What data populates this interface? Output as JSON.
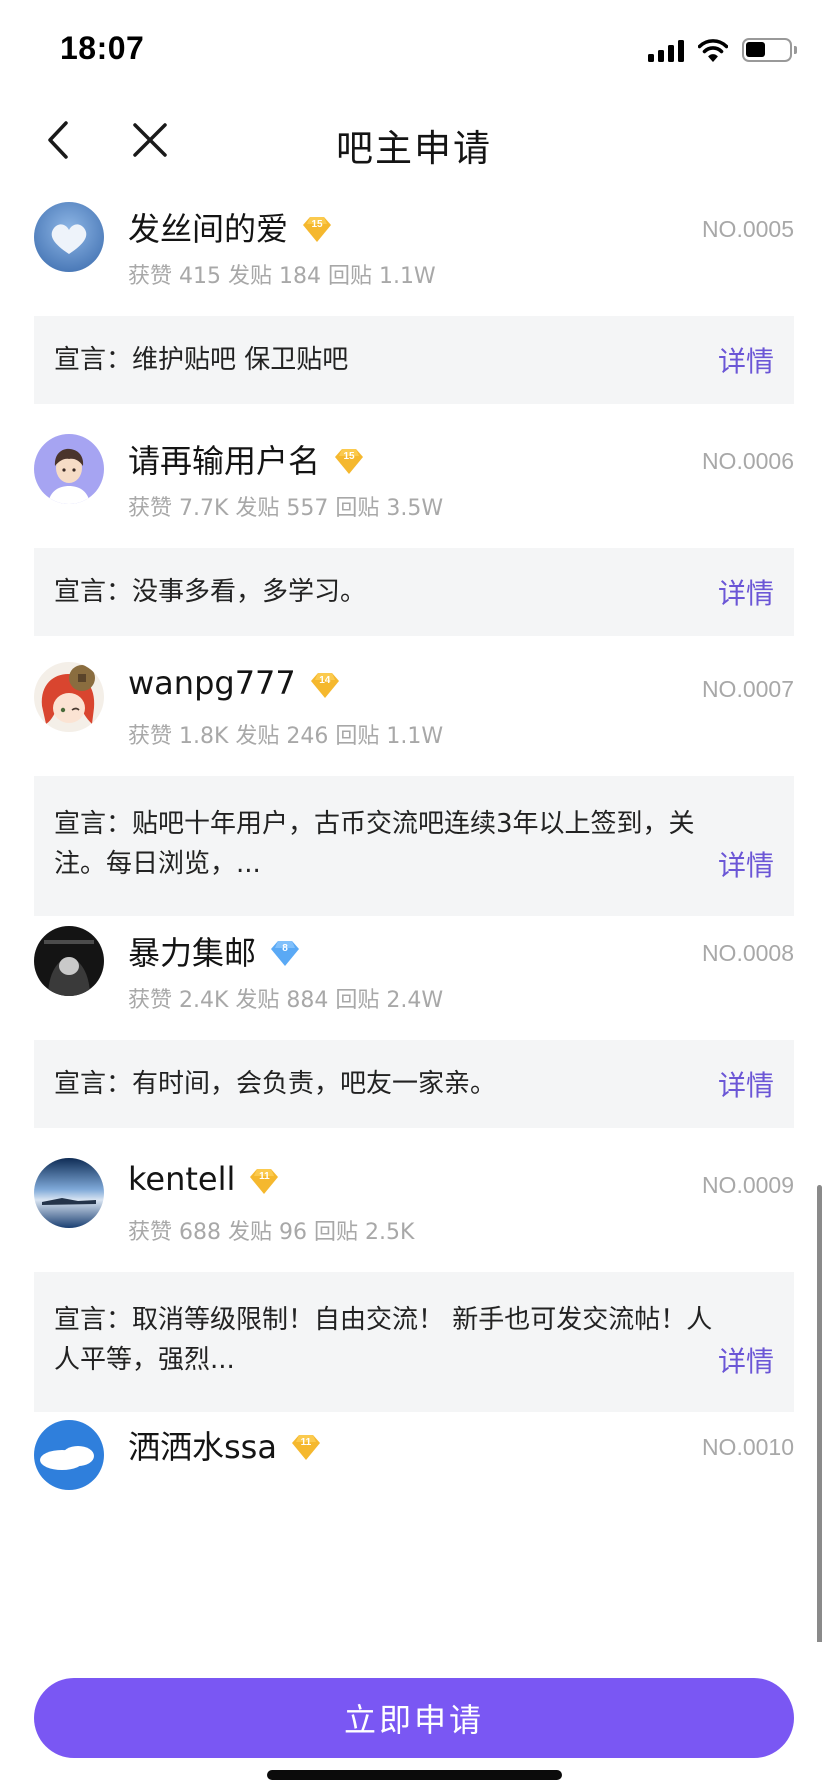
{
  "status_bar": {
    "time": "18:07"
  },
  "nav": {
    "title": "吧主申请"
  },
  "applicants": [
    {
      "name": "发丝间的爱",
      "level": "15",
      "stats": "获赞 415 发贴 184 回贴 1.1W",
      "number": "NO.0005",
      "declaration": "宣言：维护贴吧 保卫贴吧",
      "detail": "详情"
    },
    {
      "name": "请再输用户名",
      "level": "15",
      "stats": "获赞 7.7K 发贴 557 回贴 3.5W",
      "number": "NO.0006",
      "declaration": "宣言：没事多看，多学习。",
      "detail": "详情"
    },
    {
      "name": "wanpg777",
      "level": "14",
      "stats": "获赞 1.8K 发贴 246 回贴 1.1W",
      "number": "NO.0007",
      "declaration_line1": "宣言：贴吧十年用户，古币交流吧连续3年以上签到，关",
      "declaration_line2": "注。每日浏览，...",
      "detail": "详情"
    },
    {
      "name": "暴力集邮",
      "level": "8",
      "stats": "获赞 2.4K 发贴 884 回贴 2.4W",
      "number": "NO.0008",
      "declaration": "宣言：有时间，会负责，吧友一家亲。",
      "detail": "详情"
    },
    {
      "name": "kentell",
      "level": "11",
      "stats": "获赞 688 发贴 96 回贴 2.5K",
      "number": "NO.0009",
      "declaration_line1": "宣言：取消等级限制！自由交流！ 新手也可发交流帖！人",
      "declaration_line2": "人平等，强烈...",
      "detail": "详情"
    },
    {
      "name": "洒洒水ssa",
      "level": "11",
      "number": "NO.0010"
    }
  ],
  "footer": {
    "apply_label": "立即申请"
  },
  "colors": {
    "accent": "#7a57f3",
    "link": "#6b56d6",
    "badge_gold": "#f5b82e",
    "badge_blue": "#5aa9f5"
  }
}
